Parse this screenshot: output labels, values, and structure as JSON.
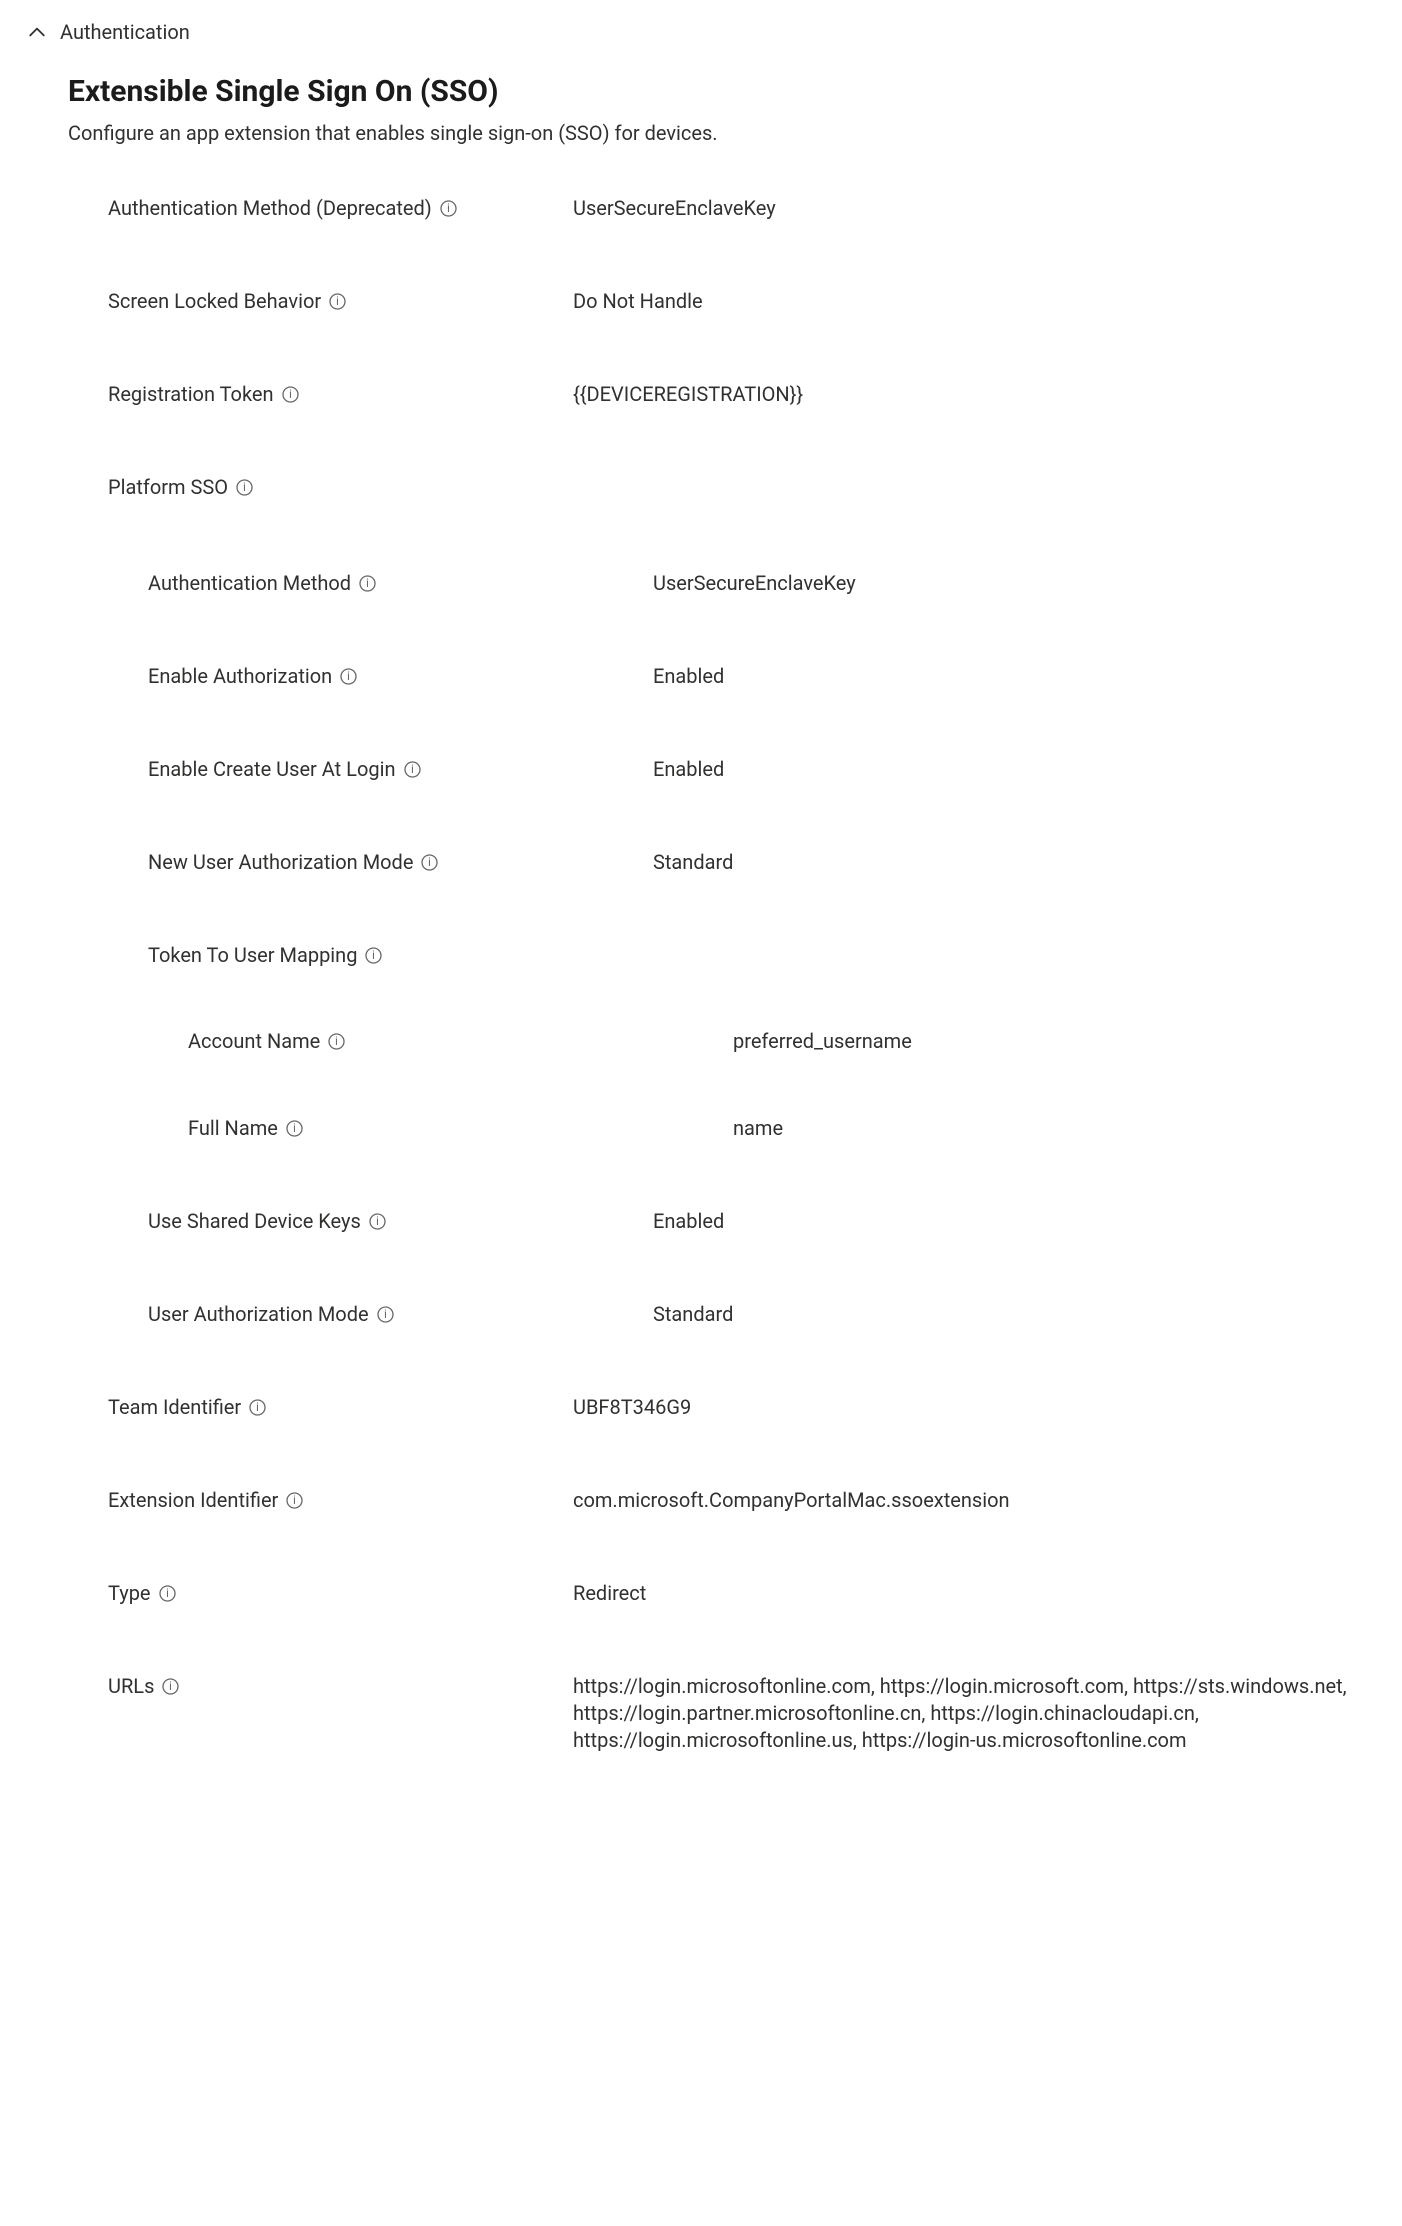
{
  "section": {
    "header": "Authentication"
  },
  "sso": {
    "title": "Extensible Single Sign On (SSO)",
    "description": "Configure an app extension that enables single sign-on (SSO) for devices.",
    "auth_method_deprecated": {
      "label": "Authentication Method (Deprecated)",
      "value": "UserSecureEnclaveKey"
    },
    "screen_locked_behavior": {
      "label": "Screen Locked Behavior",
      "value": "Do Not Handle"
    },
    "registration_token": {
      "label": "Registration Token",
      "value": "{{DEVICEREGISTRATION}}"
    },
    "platform_sso": {
      "label": "Platform SSO",
      "auth_method": {
        "label": "Authentication Method",
        "value": "UserSecureEnclaveKey"
      },
      "enable_authorization": {
        "label": "Enable Authorization",
        "value": "Enabled"
      },
      "enable_create_user": {
        "label": "Enable Create User At Login",
        "value": "Enabled"
      },
      "new_user_auth_mode": {
        "label": "New User Authorization Mode",
        "value": "Standard"
      },
      "token_to_user_mapping": {
        "label": "Token To User Mapping",
        "account_name": {
          "label": "Account Name",
          "value": "preferred_username"
        },
        "full_name": {
          "label": "Full Name",
          "value": "name"
        }
      },
      "use_shared_device_keys": {
        "label": "Use Shared Device Keys",
        "value": "Enabled"
      },
      "user_authorization_mode": {
        "label": "User Authorization Mode",
        "value": "Standard"
      }
    },
    "team_identifier": {
      "label": "Team Identifier",
      "value": "UBF8T346G9"
    },
    "extension_identifier": {
      "label": "Extension Identifier",
      "value": "com.microsoft.CompanyPortalMac.ssoextension"
    },
    "type": {
      "label": "Type",
      "value": "Redirect"
    },
    "urls": {
      "label": "URLs",
      "value": "https://login.microsoftonline.com, https://login.microsoft.com, https://sts.windows.net, https://login.partner.microsoftonline.cn, https://login.chinacloudapi.cn, https://login.microsoftonline.us, https://login-us.microsoftonline.com"
    }
  }
}
